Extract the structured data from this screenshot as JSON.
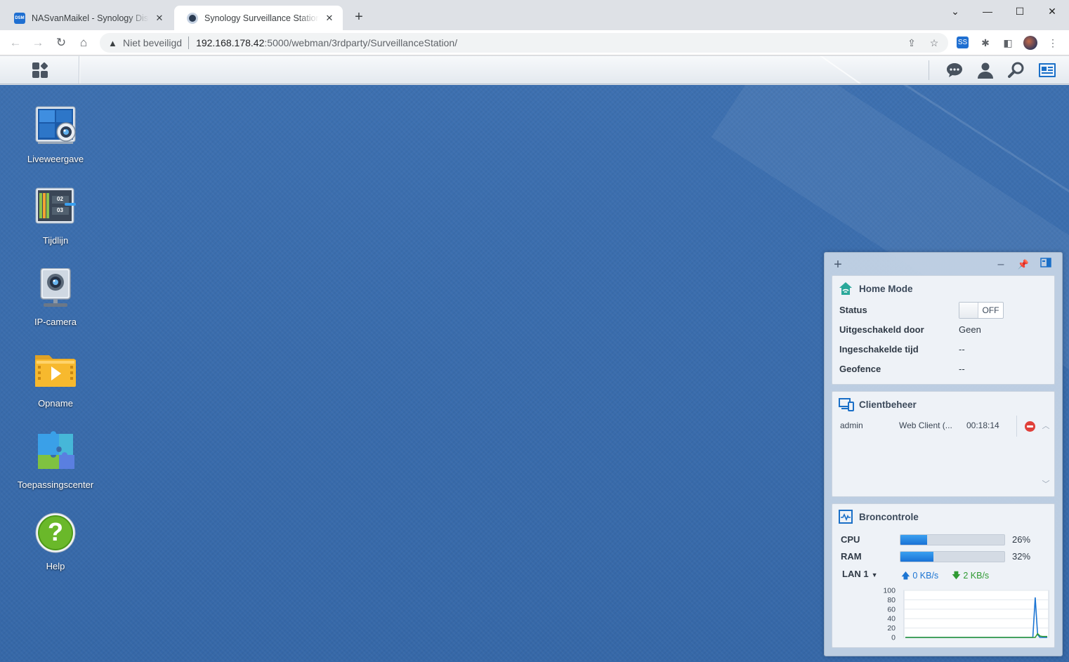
{
  "browser": {
    "tabs": [
      {
        "title": "NASvanMaikel - Synology DiskStation",
        "favicon": "DSM",
        "active": false
      },
      {
        "title": "Synology Surveillance Station - NASvanMaikel",
        "active": true
      }
    ],
    "new_tab": "+",
    "address": {
      "security_label": "Niet beveiligd",
      "host": "192.168.178.42",
      "path": ":5000/webman/3rdparty/SurveillanceStation/"
    },
    "extension_label": "SS"
  },
  "desktop": {
    "icons": [
      {
        "label": "Liveweergave",
        "icon": "live-view-icon"
      },
      {
        "label": "Tijdlijn",
        "icon": "timeline-icon",
        "tracks": [
          "02",
          "03"
        ]
      },
      {
        "label": "IP-camera",
        "icon": "ip-camera-icon"
      },
      {
        "label": "Opname",
        "icon": "recording-folder-icon"
      },
      {
        "label": "Toepassingscenter",
        "icon": "application-center-icon"
      },
      {
        "label": "Help",
        "icon": "help-icon",
        "glyph": "?"
      }
    ]
  },
  "widgets": {
    "home_mode": {
      "title": "Home Mode",
      "rows": [
        {
          "label": "Status",
          "value": "OFF"
        },
        {
          "label": "Uitgeschakeld door",
          "value": "Geen"
        },
        {
          "label": "Ingeschakelde tijd",
          "value": "--"
        },
        {
          "label": "Geofence",
          "value": "--"
        }
      ]
    },
    "client_management": {
      "title": "Clientbeheer",
      "clients": [
        {
          "user": "admin",
          "client": "Web Client (...",
          "time": "00:18:14"
        }
      ]
    },
    "resource_monitor": {
      "title": "Broncontrole",
      "cpu": {
        "label": "CPU",
        "percent": 26,
        "percent_label": "26%"
      },
      "ram": {
        "label": "RAM",
        "percent": 32,
        "percent_label": "32%"
      },
      "lan": {
        "label": "LAN 1",
        "upload": "0 KB/s",
        "download": "2 KB/s"
      }
    }
  },
  "chart_data": {
    "type": "line",
    "title": "",
    "xlabel": "",
    "ylabel": "",
    "ylim": [
      0,
      100
    ],
    "yticks": [
      100,
      80,
      60,
      40,
      20,
      0
    ],
    "grid": true,
    "series": [
      {
        "color": "#1c75d3",
        "values": [
          0,
          0,
          0,
          0,
          0,
          0,
          0,
          0,
          0,
          0,
          0,
          0,
          0,
          0,
          0,
          0,
          0,
          0,
          0,
          0,
          0,
          0,
          0,
          0,
          0,
          0,
          0,
          0,
          0,
          0,
          0,
          0,
          0,
          0,
          0,
          0,
          0,
          0,
          0,
          0,
          0,
          0,
          0,
          0,
          0,
          0,
          0,
          0,
          0,
          0,
          0,
          0,
          0,
          0,
          85,
          6,
          0,
          0,
          0,
          0
        ]
      },
      {
        "color": "#2f9a33",
        "values": [
          0,
          0,
          0,
          0,
          0,
          0,
          0,
          0,
          0,
          0,
          0,
          0,
          0,
          0,
          0,
          0,
          0,
          0,
          0,
          0,
          0,
          0,
          0,
          0,
          0,
          0,
          0,
          0,
          0,
          0,
          0,
          0,
          0,
          0,
          0,
          0,
          0,
          0,
          0,
          0,
          0,
          0,
          0,
          0,
          0,
          0,
          0,
          0,
          0,
          0,
          0,
          0,
          0,
          0,
          0,
          8,
          3,
          2,
          2,
          2
        ]
      }
    ]
  },
  "colors": {
    "desktop_bg": "#3b6dad",
    "accent": "#1c75d3",
    "upload": "#1c75d3",
    "download": "#2f9a33",
    "stop": "#e0403a"
  }
}
